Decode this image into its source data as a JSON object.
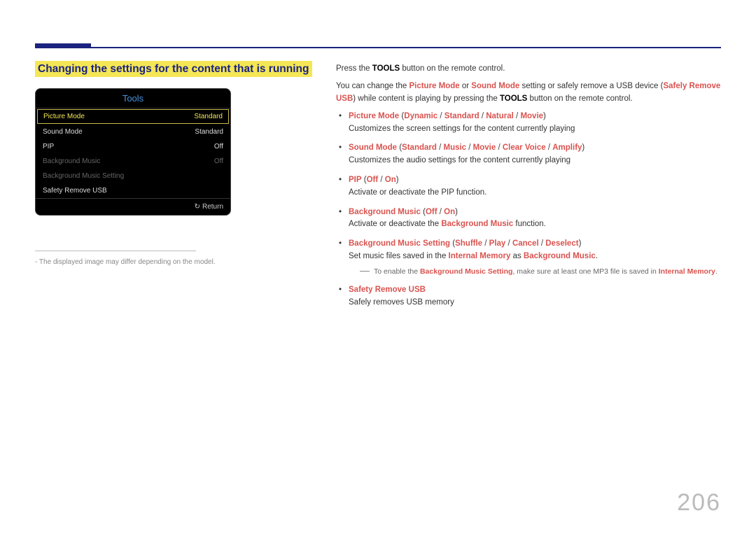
{
  "heading": "Changing the settings for the content that is running",
  "tools": {
    "title": "Tools",
    "rows": [
      {
        "label": "Picture Mode",
        "value": "Standard",
        "style": "hl"
      },
      {
        "label": "Sound Mode",
        "value": "Standard",
        "style": ""
      },
      {
        "label": "PIP",
        "value": "Off",
        "style": ""
      },
      {
        "label": "Background Music",
        "value": "Off",
        "style": "dim"
      },
      {
        "label": "Background Music Setting",
        "value": "",
        "style": "dim"
      },
      {
        "label": "Safety Remove USB",
        "value": "",
        "style": ""
      }
    ],
    "return_icon": "↻",
    "return_label": "Return"
  },
  "footnote_left": "- The displayed image may differ depending on the model.",
  "intro": {
    "p1a": "Press the ",
    "p1b": "TOOLS",
    "p1c": " button on the remote control.",
    "p2a": "You can change the ",
    "p2b": "Picture Mode",
    "p2c": " or ",
    "p2d": "Sound Mode",
    "p2e": " setting or safely remove a USB device (",
    "p2f": "Safely Remove USB",
    "p2g": ") while content is playing by pressing the ",
    "p2h": "TOOLS",
    "p2i": " button on the remote control."
  },
  "items": {
    "i1": {
      "name": "Picture Mode",
      "opts": [
        "Dynamic",
        "Standard",
        "Natural",
        "Movie"
      ],
      "desc": "Customizes the screen settings for the content currently playing"
    },
    "i2": {
      "name": "Sound Mode",
      "opts": [
        "Standard",
        "Music",
        "Movie",
        "Clear Voice",
        "Amplify"
      ],
      "desc": "Customizes the audio settings for the content currently playing"
    },
    "i3": {
      "name": "PIP",
      "opts": [
        "Off",
        "On"
      ],
      "desc": "Activate or deactivate the PIP function."
    },
    "i4": {
      "name": "Background Music",
      "opts": [
        "Off",
        "On"
      ],
      "desc_a": "Activate or deactivate the ",
      "desc_b": "Background Music",
      "desc_c": " function."
    },
    "i5": {
      "name": "Background Music Setting",
      "opts": [
        "Shuffle",
        "Play",
        "Cancel",
        "Deselect"
      ],
      "desc_a": "Set music files saved in the ",
      "desc_b": "Internal Memory",
      "desc_c": " as ",
      "desc_d": "Background Music",
      "desc_e": "."
    },
    "note": {
      "a": "To enable the ",
      "b": "Background Music Setting",
      "c": ", make sure at least one MP3 file is saved in ",
      "d": "Internal Memory",
      "e": "."
    },
    "i6": {
      "name": "Safety Remove USB",
      "desc": "Safely removes USB memory"
    }
  },
  "sep": " / ",
  "page_number": "206"
}
